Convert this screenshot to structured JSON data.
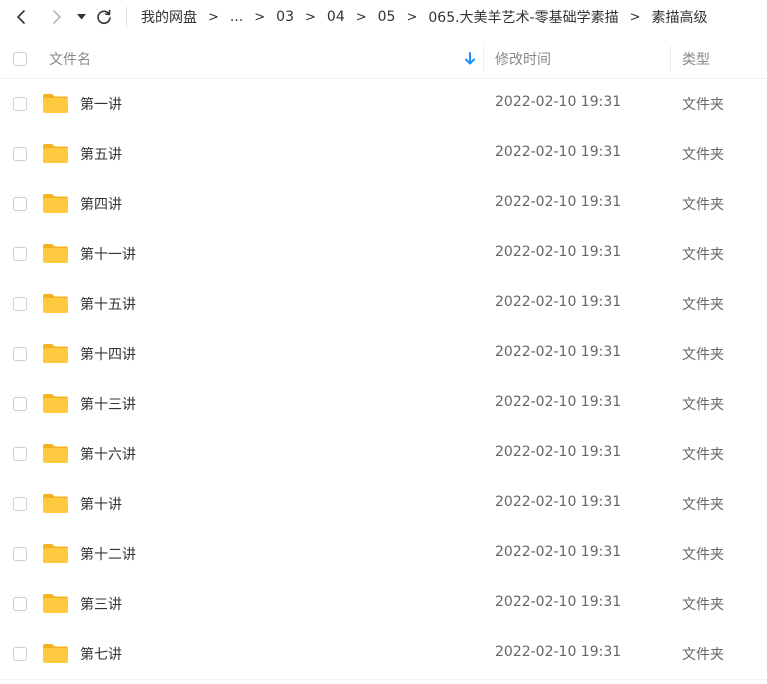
{
  "navbar": {
    "back_icon": "chevron-left-icon",
    "forward_icon": "chevron-right-icon",
    "dropdown_icon": "caret-down-icon",
    "refresh_icon": "refresh-icon",
    "separator": ">",
    "breadcrumbs": [
      "我的网盘",
      "...",
      "03",
      "04",
      "05",
      "065.大美羊艺术-零基础学素描",
      "素描高级"
    ]
  },
  "header": {
    "name_label": "文件名",
    "time_label": "修改时间",
    "type_label": "类型",
    "sort_icon": "sort-down-arrow-icon",
    "sort_color": "#1890ff"
  },
  "colors": {
    "folder": "#ffc940",
    "folder_tab": "#f5b21e",
    "text": "#333333",
    "muted": "#666666"
  },
  "files": [
    {
      "name": "第一讲",
      "modified": "2022-02-10 19:31",
      "type": "文件夹"
    },
    {
      "name": "第五讲",
      "modified": "2022-02-10 19:31",
      "type": "文件夹"
    },
    {
      "name": "第四讲",
      "modified": "2022-02-10 19:31",
      "type": "文件夹"
    },
    {
      "name": "第十一讲",
      "modified": "2022-02-10 19:31",
      "type": "文件夹"
    },
    {
      "name": "第十五讲",
      "modified": "2022-02-10 19:31",
      "type": "文件夹"
    },
    {
      "name": "第十四讲",
      "modified": "2022-02-10 19:31",
      "type": "文件夹"
    },
    {
      "name": "第十三讲",
      "modified": "2022-02-10 19:31",
      "type": "文件夹"
    },
    {
      "name": "第十六讲",
      "modified": "2022-02-10 19:31",
      "type": "文件夹"
    },
    {
      "name": "第十讲",
      "modified": "2022-02-10 19:31",
      "type": "文件夹"
    },
    {
      "name": "第十二讲",
      "modified": "2022-02-10 19:31",
      "type": "文件夹"
    },
    {
      "name": "第三讲",
      "modified": "2022-02-10 19:31",
      "type": "文件夹"
    },
    {
      "name": "第七讲",
      "modified": "2022-02-10 19:31",
      "type": "文件夹"
    }
  ]
}
